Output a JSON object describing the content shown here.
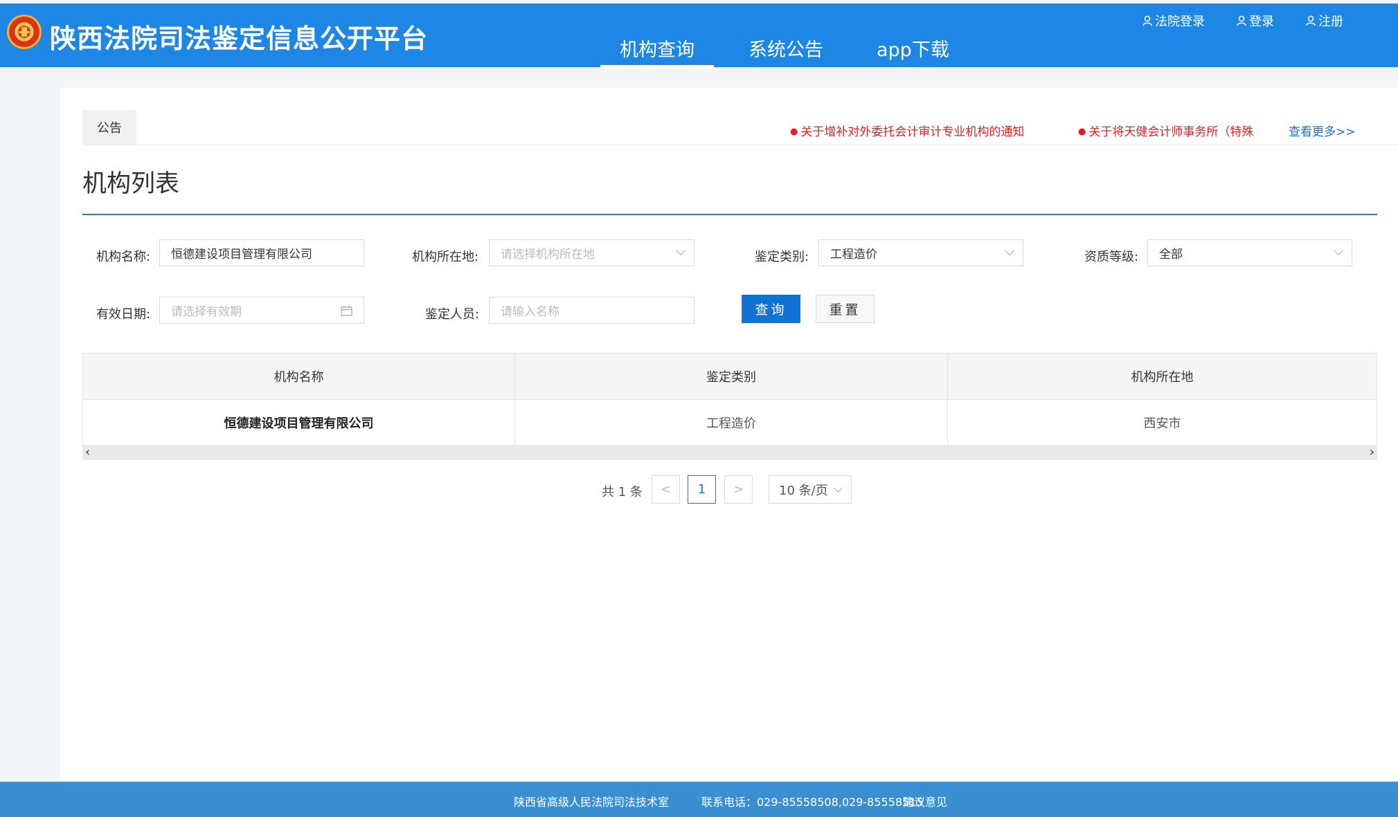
{
  "colors": {
    "header_bg": "#1e87e5",
    "primary": "#1173d4",
    "notice_red": "#e02020",
    "link_blue": "#1e6fc9",
    "footer_bg": "#3a8fd2"
  },
  "header": {
    "logo_icon": "court-emblem-icon",
    "title": "陕西法院司法鉴定信息公开平台",
    "nav": [
      {
        "label": "机构查询",
        "active": true
      },
      {
        "label": "系统公告",
        "active": false
      },
      {
        "label": "app下载",
        "active": false
      }
    ],
    "user_links": [
      {
        "icon": "user-icon",
        "label": "法院登录"
      },
      {
        "icon": "user-icon",
        "label": "登录"
      },
      {
        "icon": "user-icon",
        "label": "注册"
      }
    ]
  },
  "notices": {
    "tab_label": "公告",
    "items": [
      "关于增补对外委托会计审计专业机构的通知",
      "关于将天健会计师事务所（特殊"
    ],
    "more_label": "查看更多>>"
  },
  "page": {
    "title": "机构列表"
  },
  "search": {
    "org_name": {
      "label": "机构名称:",
      "value": "恒德建设项目管理有限公司"
    },
    "org_location": {
      "label": "机构所在地:",
      "placeholder": "请选择机构所在地"
    },
    "category": {
      "label": "鉴定类别:",
      "value": "工程造价"
    },
    "qualification": {
      "label": "资质等级:",
      "value": "全部"
    },
    "valid_date": {
      "label": "有效日期:",
      "placeholder": "请选择有效期"
    },
    "appraiser": {
      "label": "鉴定人员:",
      "placeholder": "请输入名称"
    },
    "query_button": "查询",
    "reset_button": "重置"
  },
  "table": {
    "columns": [
      "机构名称",
      "鉴定类别",
      "机构所在地"
    ],
    "rows": [
      [
        "恒德建设项目管理有限公司",
        "工程造价",
        "西安市"
      ]
    ]
  },
  "pagination": {
    "total_text": "共 1 条",
    "prev": "<",
    "current_page": "1",
    "next": ">",
    "page_size": "10 条/页"
  },
  "footer": {
    "org": "陕西省高级人民法院司法技术室",
    "contact": "联系电话：029-85558508,029-85558515",
    "feedback": "建议意见"
  }
}
